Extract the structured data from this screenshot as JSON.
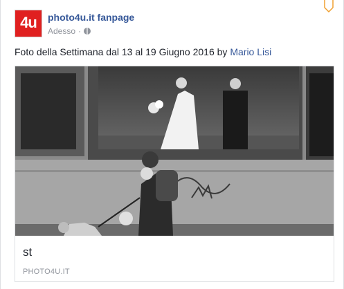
{
  "post": {
    "logo_text": "4u",
    "page_name": "photo4u.it fanpage",
    "timestamp": "Adesso",
    "separator": "·",
    "text_prefix": "Foto della Settimana dal 13 al 19 Giugno 2016 by ",
    "author": "Mario Lisi"
  },
  "link": {
    "title": "st",
    "domain": "PHOTO4U.IT"
  },
  "icons": {
    "privacy": "globe-icon",
    "options": "chevron-down-icon"
  },
  "colors": {
    "link_blue": "#365899",
    "logo_red": "#e02020",
    "muted_text": "#90949c",
    "options_orange": "#f0a030"
  }
}
